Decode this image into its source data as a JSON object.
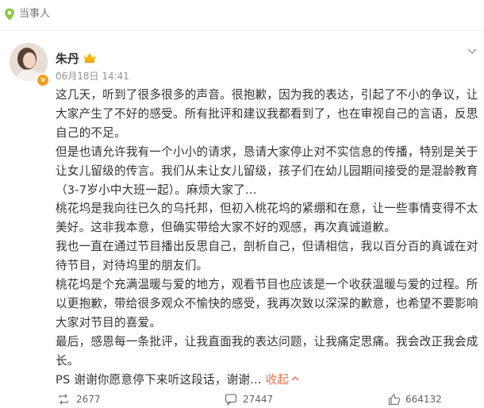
{
  "topic": {
    "label": "当事人",
    "icon": "location-pin-icon",
    "icon_color": "#8cc63f"
  },
  "post": {
    "username": "朱丹",
    "timestamp": "06月18日 14:41",
    "verified_color": "#f0a020",
    "paragraphs": [
      "这几天，听到了很多很多的声音。很抱歉，因为我的表达，引起了不小的争议，让大家产生了不好的感受。所有批评和建议我都看到了，也在审视自己的言语，反思自己的不足。",
      "但是也请允许我有一个小小的请求，恳请大家停止对不实信息的传播，特别是关于让女儿留级的传言。我们从未让女儿留级，孩子们在幼儿园期间接受的是混龄教育（3-7岁小中大班一起）。麻烦大家了...",
      "桃花坞是我向往已久的乌托邦，但初入桃花坞的紧绷和在意，让一些事情变得不太美好。这非我本意，但确实带给大家不好的观感，再次真诚道歉。",
      "我也一直在通过节目播出反思自己，剖析自己，但请相信，我以百分百的真诚在对待节目，对待坞里的朋友们。",
      "桃花坞是个充满温暖与爱的地方，观看节目也应该是一个收获温暖与爱的过程。所以更抱歉，带给很多观众不愉快的感受，我再次致以深深的歉意，也希望不要影响大家对节目的喜爱。",
      "最后，感恩每一条批评，让我直面我的表达问题，让我痛定思痛。我会改正我会成长。",
      "PS 谢谢你愿意停下来听这段话，谢谢..."
    ],
    "collapse_label": "收起",
    "accent_color": "#eb7350"
  },
  "actions": {
    "repost_count": "2677",
    "comment_count": "27447",
    "like_count": "664132"
  }
}
